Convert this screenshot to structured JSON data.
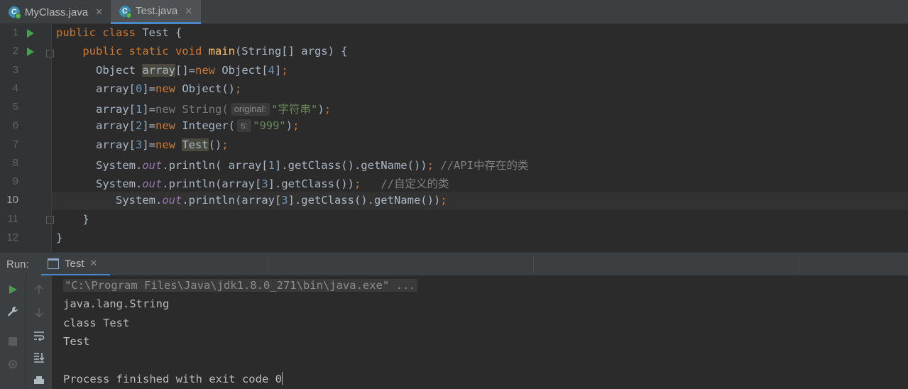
{
  "tabs": [
    {
      "label": "MyClass.java",
      "icon": "java-class-icon",
      "active": false
    },
    {
      "label": "Test.java",
      "icon": "java-class-icon",
      "active": true
    }
  ],
  "editor": {
    "line_numbers": [
      "1",
      "2",
      "3",
      "4",
      "5",
      "6",
      "7",
      "8",
      "9",
      "10",
      "11",
      "12"
    ],
    "current_line": 10,
    "hints": {
      "original": "original:",
      "s": "s:"
    }
  },
  "run_panel": {
    "label": "Run:",
    "tab_label": "Test",
    "output": [
      "\"C:\\Program Files\\Java\\jdk1.8.0_271\\bin\\java.exe\" ...",
      "java.lang.String",
      "class Test",
      "Test",
      "",
      "Process finished with exit code 0"
    ]
  },
  "colors": {
    "background": "#2b2b2b",
    "keyword": "#cc7832",
    "string": "#6a8759",
    "number": "#6897bb",
    "method_decl": "#ffc66d",
    "static_field": "#9876aa",
    "comment": "#808080",
    "run_green": "#499c54",
    "tab_accent": "#4a88c7"
  }
}
